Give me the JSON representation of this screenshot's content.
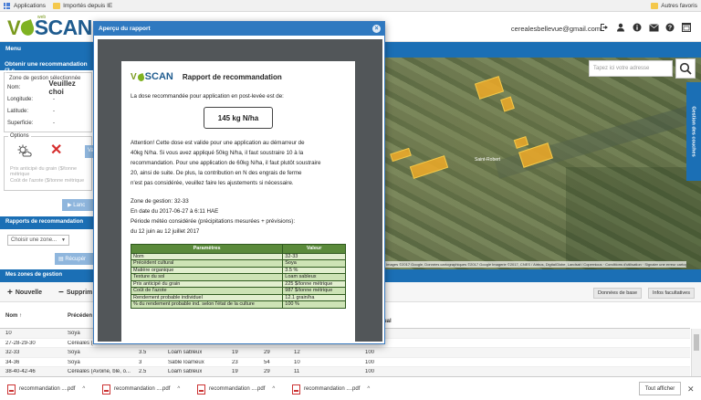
{
  "browser": {
    "bookmarks": [
      {
        "label": "Applications",
        "icon": "apps-grid-icon"
      },
      {
        "label": "Importés depuis IE",
        "icon": "folder-icon"
      }
    ],
    "other_bookmarks": "Autres favoris"
  },
  "header": {
    "logo_v": "V",
    "logo_text": "SCAN",
    "logo_web": "web",
    "user_email": "cerealesbellevue@gmail.com",
    "icons": [
      "sign-out-icon",
      "user-icon",
      "info-icon",
      "mail-icon",
      "help-icon",
      "window-icon"
    ]
  },
  "menu": {
    "label": "Menu"
  },
  "left_panel": {
    "title": "Obtenir une recommandation (3 c",
    "zone_legend": "Zone de gestion sélectionnée",
    "fields": [
      {
        "label": "Nom:",
        "value": "Veuillez choi"
      },
      {
        "label": "Longitude:",
        "value": "-"
      },
      {
        "label": "Latitude:",
        "value": "-"
      },
      {
        "label": "Superficie:",
        "value": "-"
      }
    ],
    "options_legend": "Options",
    "va_label": "Va",
    "prix_placeholder": "Prix anticipé du grain ($/tonne métrique",
    "cout_placeholder": "Coût de l'azote ($/tonne métrique",
    "lancer_label": "Lanc",
    "rapports_title": "Rapports de recommandation",
    "zone_select": "Choisir une zone...",
    "recuperer_label": "Récupér"
  },
  "map": {
    "search_placeholder": "Tapez ici votre adresse",
    "place_label": "Saint-Robert",
    "side_tab": "Gestion des couches",
    "attribution": "Images ©2017 Google, Données cartographiques ©2017 Google Imagerie ©2017, CNES / Airbus, DigitalGlobe, Landsat / Copernicus · Conditions d'utilisation · Signaler une erreur cartographique"
  },
  "zones": {
    "title": "Mes zones de gestion",
    "new_label": "Nouvelle",
    "delete_label": "Supprim",
    "tab_base": "Données de base",
    "tab_optional": "Infos facultatives",
    "columns": [
      "Nom ↑",
      "Précéden",
      "",
      "",
      "",
      "",
      "ual"
    ],
    "rows": [
      [
        "10",
        "Soya",
        "",
        "",
        "",
        "",
        ""
      ],
      [
        "27-28-29-30",
        "Céréales (Avoine, blé, o...",
        "",
        "",
        "",
        "",
        ""
      ],
      [
        "32-33",
        "Soya",
        "3.5",
        "Loam sableux",
        "19",
        "29",
        "12",
        "100"
      ],
      [
        "34-36",
        "Soya",
        "3",
        "Sable loameux",
        "23",
        "54",
        "10",
        "100"
      ],
      [
        "38-40-42-46",
        "Céréales (Avoine, blé, o...",
        "2.5",
        "Loam sableux",
        "19",
        "29",
        "11",
        "100"
      ]
    ]
  },
  "downloads": {
    "items": [
      "recommandation ....pdf",
      "recommandation ....pdf",
      "recommandation ....pdf",
      "recommandation ....pdf"
    ],
    "show_all": "Tout afficher"
  },
  "modal": {
    "title": "Aperçu du rapport",
    "doc_title": "Rapport de recommandation",
    "intro": "La dose recommandée pour application en post-levée est de:",
    "dose": "145 kg N/ha",
    "warning": [
      "Attention! Cette dose est valide pour une application au démarreur de",
      "40kg N/ha. Si vous avez appliqué 50kg N/ha, il faut soustraire 10 à la",
      "recommandation. Pour une application de 60kg N/ha, il faut plutôt soustraire",
      "20, ainsi de suite. De plus, la contribution en N des engrais de ferme",
      "n'est pas considérée, veuillez faire les ajustements si nécessaire."
    ],
    "details": [
      "Zone de gestion: 32-33",
      "En date du 2017-06-27 à 6:11 HAE",
      "Période météo considérée (précipitations mesurées + prévisions):",
      "du 12 juin au 12 juillet 2017"
    ],
    "table_headers": [
      "Paramètres",
      "Valeur"
    ],
    "table_rows": [
      [
        "Nom",
        "32-33"
      ],
      [
        "Précédent cultural",
        "Soya"
      ],
      [
        "Matière organique",
        "3.5 %"
      ],
      [
        "Texture du sol",
        "Loam sableux"
      ],
      [
        "Prix anticipé du grain",
        "225 $/tonne métrique"
      ],
      [
        "Coût de l'azote",
        "987 $/tonne métrique"
      ],
      [
        "Rendement probable individuel",
        "12.1 grain/ha"
      ],
      [
        "% du rendement probable ind. selon l'état de la culture",
        "100 %"
      ]
    ]
  }
}
